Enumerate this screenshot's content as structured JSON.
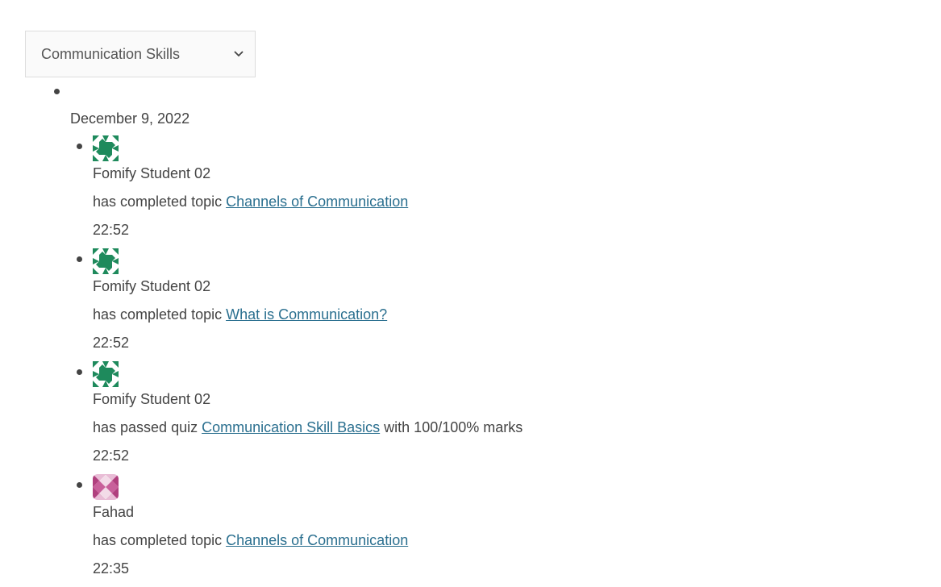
{
  "course_filter": {
    "selected": "Communication Skills",
    "icon": "chevron-down-icon"
  },
  "activity_group": {
    "date": "December 9, 2022",
    "items": [
      {
        "user": "Fomify Student 02",
        "avatar": "green-identicon",
        "action_prefix": "has completed topic ",
        "link": "Channels of Communication",
        "action_suffix": "",
        "time": "22:52"
      },
      {
        "user": "Fomify Student 02",
        "avatar": "green-identicon",
        "action_prefix": "has completed topic ",
        "link": "What is Communication?",
        "action_suffix": "",
        "time": "22:52"
      },
      {
        "user": "Fomify Student 02",
        "avatar": "green-identicon",
        "action_prefix": "has passed quiz ",
        "link": "Communication Skill Basics",
        "action_suffix": " with 100/100% marks",
        "time": "22:52"
      },
      {
        "user": "Fahad",
        "avatar": "pink-identicon",
        "action_prefix": "has completed topic ",
        "link": "Channels of Communication",
        "action_suffix": "",
        "time": "22:35"
      }
    ]
  },
  "colors": {
    "link": "#2a6f8f",
    "green_avatar": "#1e8a5c",
    "pink_avatar": "#b0407e"
  }
}
